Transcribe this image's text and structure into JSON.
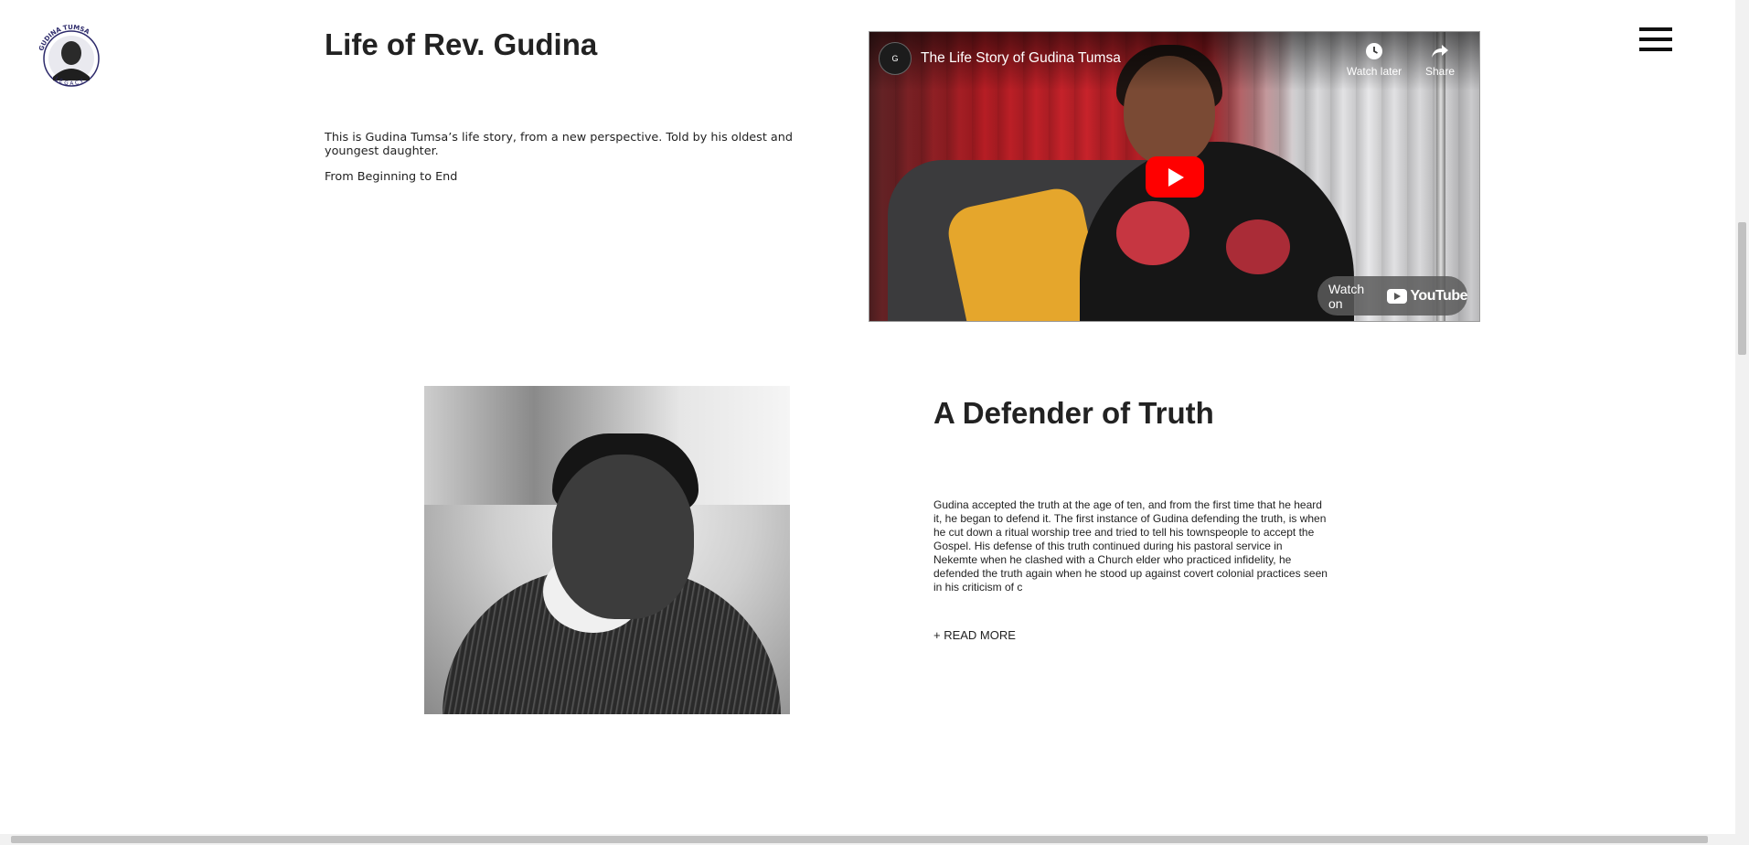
{
  "header": {
    "logo_top_text": "GUDINA TUMSA",
    "logo_bottom_text": "LEGACY",
    "menu_icon": "hamburger-menu-icon"
  },
  "life_section": {
    "title": "Life of Rev. Gudina",
    "description": "This is Gudina Tumsa’s life story, from a new perspective. Told by his oldest and youngest daughter.",
    "subtitle": "From Beginning to End"
  },
  "video": {
    "title": "The Life Story of Gudina Tumsa",
    "watch_later": "Watch later",
    "share": "Share",
    "watch_on": "Watch on",
    "youtube": "YouTube",
    "play_icon": "play-icon",
    "brand_color": "#ff0000"
  },
  "truth_section": {
    "title": "A Defender of Truth",
    "body": "Gudina accepted the truth at the age of ten, and from the first time that he heard it, he began to defend it. The first instance of Gudina defending the truth, is when he cut down a ritual worship tree and tried to tell his townspeople to accept the Gospel. His defense of this truth continued during his pastoral service in Nekemte when he clashed with a Church elder who practiced infidelity, he defended the truth again when he stood up against covert colonial practices seen in his criticism of c",
    "read_more": "+ READ MORE"
  }
}
